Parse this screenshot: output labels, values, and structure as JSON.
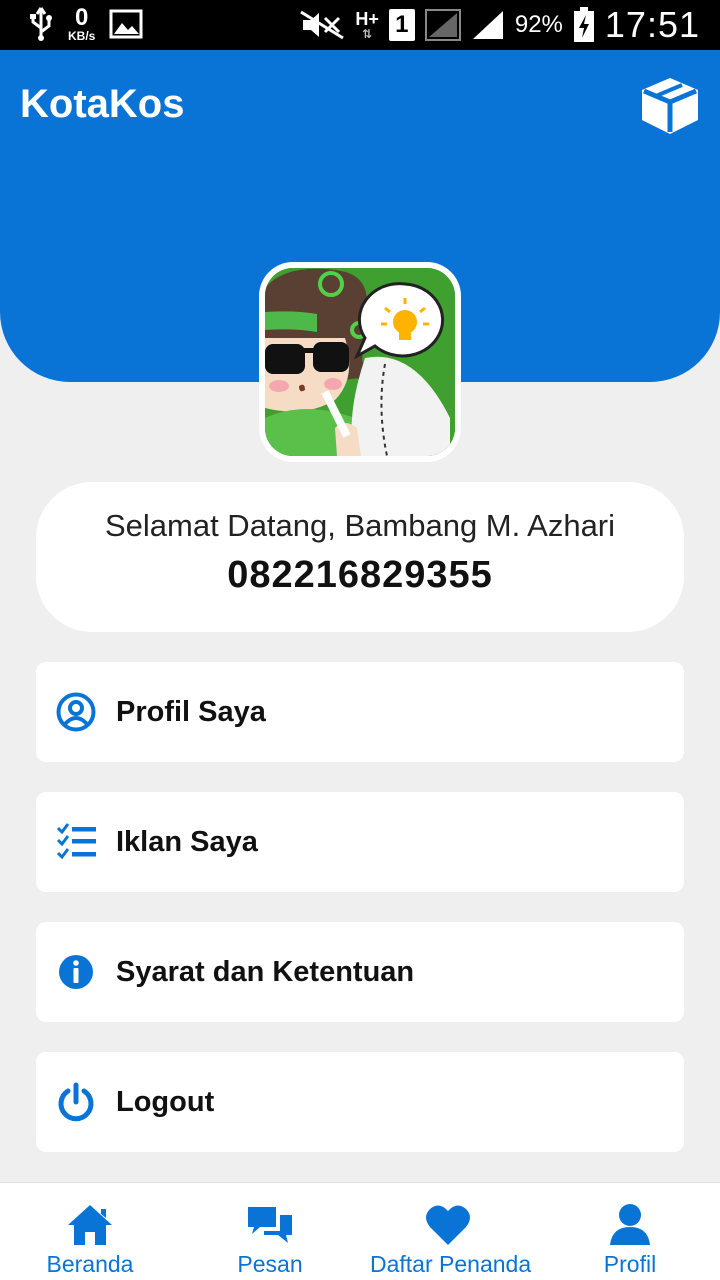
{
  "status_bar": {
    "kbs_value": "0",
    "kbs_unit": "KB/s",
    "network_type": "H+",
    "sim_slot": "1",
    "battery": "92%",
    "time": "17:51"
  },
  "header": {
    "title": "KotaKos",
    "action_icon": "package-box-icon"
  },
  "profile": {
    "welcome": "Selamat Datang, Bambang M. Azhari",
    "phone": "082216829355"
  },
  "menu": [
    {
      "label": "Profil Saya",
      "icon": "user-circle-icon"
    },
    {
      "label": "Iklan Saya",
      "icon": "checklist-icon"
    },
    {
      "label": "Syarat dan Ketentuan",
      "icon": "info-icon"
    },
    {
      "label": "Logout",
      "icon": "power-icon"
    }
  ],
  "bottom_nav": [
    {
      "label": "Beranda",
      "icon": "home-icon"
    },
    {
      "label": "Pesan",
      "icon": "chat-icon"
    },
    {
      "label": "Daftar Penanda",
      "icon": "heart-icon"
    },
    {
      "label": "Profil",
      "icon": "person-icon"
    }
  ],
  "colors": {
    "primary": "#0a74d6",
    "background": "#efefef"
  }
}
